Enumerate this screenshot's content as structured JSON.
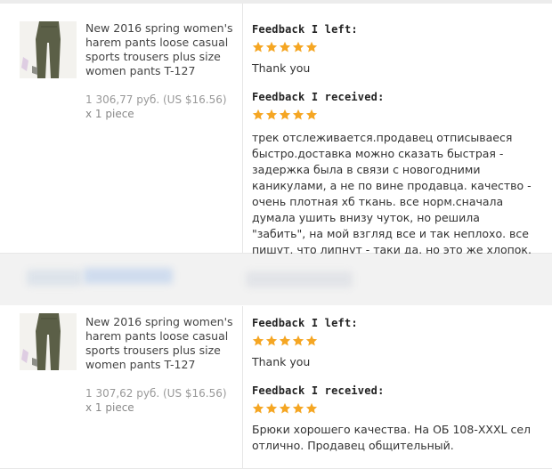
{
  "feedback_records": [
    {
      "product_title": "New 2016 spring women's harem pants loose casual sports trousers plus size women pants T-127",
      "price": "1 306,77 руб. (US $16.56)",
      "quantity": "x 1 piece",
      "left_header": "Feedback I left:",
      "left_rating": 5,
      "left_text": "Thank you",
      "received_header": "Feedback I received:",
      "received_rating": 5,
      "received_text": "трек отслеживается.продавец отписываеся быстро.доставка можно сказать быстрая - задержка была в связи с новогодними каникулами, а не по вине продавца. качество - очень плотная хб ткань. все норм.сначала думала ушить внизу чуток, но решила \"забить\", на мой взгляд все и так неплохо. все пишут, что липнут - таки да, но это же хлопок."
    },
    {
      "product_title": "New 2016 spring women's harem pants loose casual sports trousers plus size women pants T-127",
      "price": "1 307,62 руб. (US $16.56)",
      "quantity": "x 1 piece",
      "left_header": "Feedback I left:",
      "left_rating": 5,
      "left_text": "Thank you",
      "received_header": "Feedback I received:",
      "received_rating": 5,
      "received_text": "Брюки хорошего качества. На ОБ 108-XXXL сел отлично. Продавец общительный."
    }
  ],
  "colors": {
    "star": "#f5a623",
    "divider_band": "#f2f2f2",
    "price_text": "#999999"
  },
  "icons": {
    "rating_star": "star-icon",
    "product_image": "product-thumbnail"
  }
}
